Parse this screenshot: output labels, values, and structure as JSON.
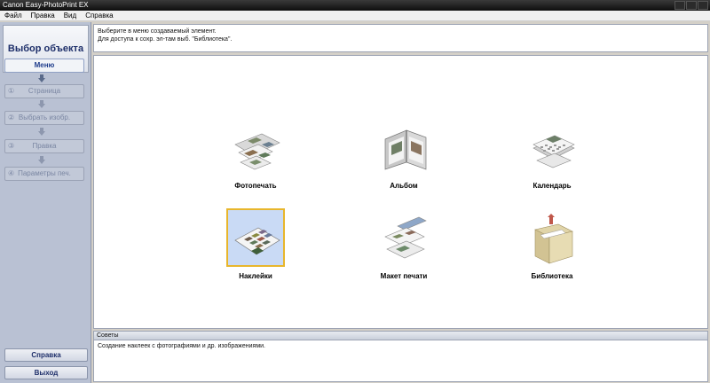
{
  "window": {
    "title": "Canon Easy-PhotoPrint EX"
  },
  "menubar": {
    "items": [
      "Файл",
      "Правка",
      "Вид",
      "Справка"
    ]
  },
  "sidebar": {
    "header": "Выбор объекта",
    "steps": [
      {
        "label": "Меню",
        "num": ""
      },
      {
        "label": "Страница",
        "num": "①"
      },
      {
        "label": "Выбрать изобр.",
        "num": "②"
      },
      {
        "label": "Правка",
        "num": "③"
      },
      {
        "label": "Параметры печ.",
        "num": "④"
      }
    ],
    "help_label": "Справка",
    "exit_label": "Выход"
  },
  "instructions": {
    "line1": "Выберите в меню создаваемый элемент.",
    "line2": "Для доступа к сохр. эл-там выб. \"Библиотека\"."
  },
  "items": [
    {
      "label": "Фотопечать",
      "icon": "photo-print-icon"
    },
    {
      "label": "Альбом",
      "icon": "album-icon"
    },
    {
      "label": "Календарь",
      "icon": "calendar-icon"
    },
    {
      "label": "Наклейки",
      "icon": "stickers-icon",
      "selected": true
    },
    {
      "label": "Макет печати",
      "icon": "layout-print-icon"
    },
    {
      "label": "Библиотека",
      "icon": "library-icon"
    }
  ],
  "tips": {
    "title": "Советы",
    "text": "Создание наклеек с фотографиями и др. изображениями."
  }
}
